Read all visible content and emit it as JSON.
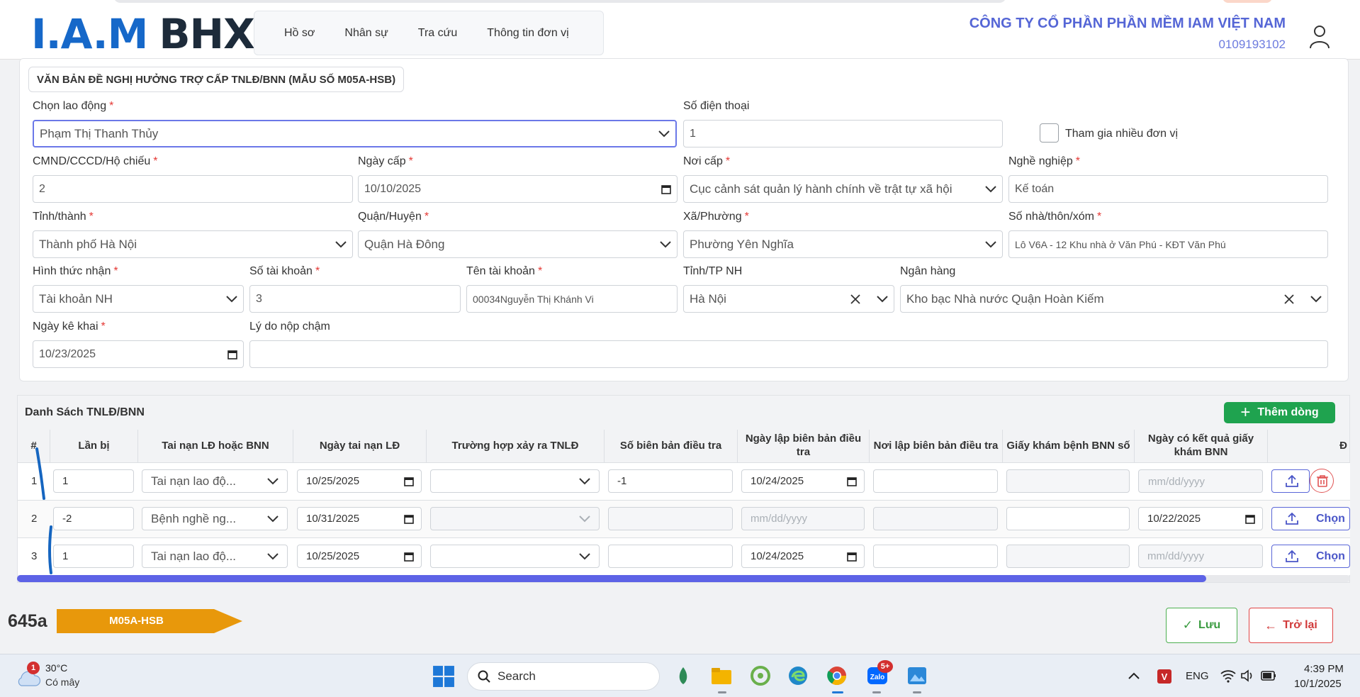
{
  "app": {
    "logo_left": "I.A.M",
    "logo_right": "BHXH",
    "nav": [
      "Hồ sơ",
      "Nhân sự",
      "Tra cứu",
      "Thông tin đơn vị"
    ],
    "company_name": "CÔNG TY CỔ PHẦN PHẦN MỀM IAM VIỆT NAM",
    "company_tax": "0109193102"
  },
  "form": {
    "legend": "VĂN BẢN ĐỀ NGHỊ HƯỞNG TRỢ CẤP TNLĐ/BNN (MẪU SỐ M05A-HSB)",
    "labels": {
      "employee": "Chọn lao động",
      "phone": "Số điện thoại",
      "multi_unit": "Tham gia nhiều đơn vị",
      "id_no": "CMND/CCCD/Hộ chiếu",
      "issue_date": "Ngày cấp",
      "issue_place": "Nơi cấp",
      "occupation": "Nghề nghiệp",
      "province": "Tỉnh/thành",
      "district": "Quận/Huyện",
      "ward": "Xã/Phường",
      "address": "Số nhà/thôn/xóm",
      "receive_method": "Hình thức nhận",
      "account_no": "Số tài khoản",
      "account_name": "Tên tài khoản",
      "bank_province": "Tỉnh/TP NH",
      "bank": "Ngân hàng",
      "declare_date": "Ngày kê khai",
      "late_reason": "Lý do nộp chậm"
    },
    "values": {
      "employee": "Phạm Thị Thanh Thủy",
      "phone": "1",
      "id_no": "2",
      "issue_date": "10/10/2025",
      "issue_place": "Cục cảnh sát quản lý hành chính về trật tự xã hội",
      "occupation": "Kế toán",
      "province": "Thành phố Hà Nội",
      "district": "Quận Hà Đông",
      "ward": "Phường Yên Nghĩa",
      "address": "Lô V6A - 12 Khu nhà ở Văn Phú - KĐT Văn Phú",
      "receive_method": "Tài khoản NH",
      "account_no": "3",
      "account_name": "00034Nguyễn Thị Khánh Vi",
      "bank_province": "Hà Nội",
      "bank": "Kho bạc Nhà nước Quận Hoàn Kiếm",
      "declare_date": "10/23/2025",
      "late_reason": ""
    },
    "multi_unit_checked": false
  },
  "table": {
    "title": "Danh Sách TNLĐ/BNN",
    "add_label": "Thêm dòng",
    "headers": [
      "#",
      "Lần bị",
      "Tai nạn LĐ hoặc BNN",
      "Ngày tai nạn LĐ",
      "Trường hợp xảy ra TNLĐ",
      "Số biên bản điều tra",
      "Ngày lập biên bản điều tra",
      "Nơi lập biên bản điều tra",
      "Giấy khám bệnh BNN số",
      "Ngày có kết quả giấy khám BNN",
      "Đ"
    ],
    "date_placeholder": "mm/dd/yyyy",
    "choose_label": "Chọn",
    "rows": [
      {
        "no": "1",
        "times": "1",
        "type": "Tai nạn lao độ...",
        "accident_date": "10/25/2025",
        "case": "",
        "report_no": "-1",
        "report_date": "10/24/2025",
        "report_place": "",
        "bnn_paper": "",
        "bnn_date": ""
      },
      {
        "no": "2",
        "times": "-2",
        "type": "Bệnh nghề ng...",
        "accident_date": "10/31/2025",
        "case": "",
        "report_no": "",
        "report_date": "",
        "report_place": "",
        "bnn_paper": "",
        "bnn_date": "10/22/2025"
      },
      {
        "no": "3",
        "times": "1",
        "type": "Tai nạn lao độ...",
        "accident_date": "10/25/2025",
        "case": "",
        "report_no": "",
        "report_date": "10/24/2025",
        "report_place": "",
        "bnn_paper": "",
        "bnn_date": ""
      }
    ]
  },
  "footer": {
    "code": "645a",
    "form_badge": "M05A-HSB",
    "save_label": "Lưu",
    "back_label": "Trở lại",
    "accent": "#e8980b"
  },
  "taskbar": {
    "weather_temp": "30°C",
    "weather_desc": "Có mây",
    "weather_badge": "1",
    "search_label": "Search",
    "zalo_badge": "5+",
    "lang": "ENG",
    "time": "4:39 PM",
    "date": "10/1/2025"
  }
}
